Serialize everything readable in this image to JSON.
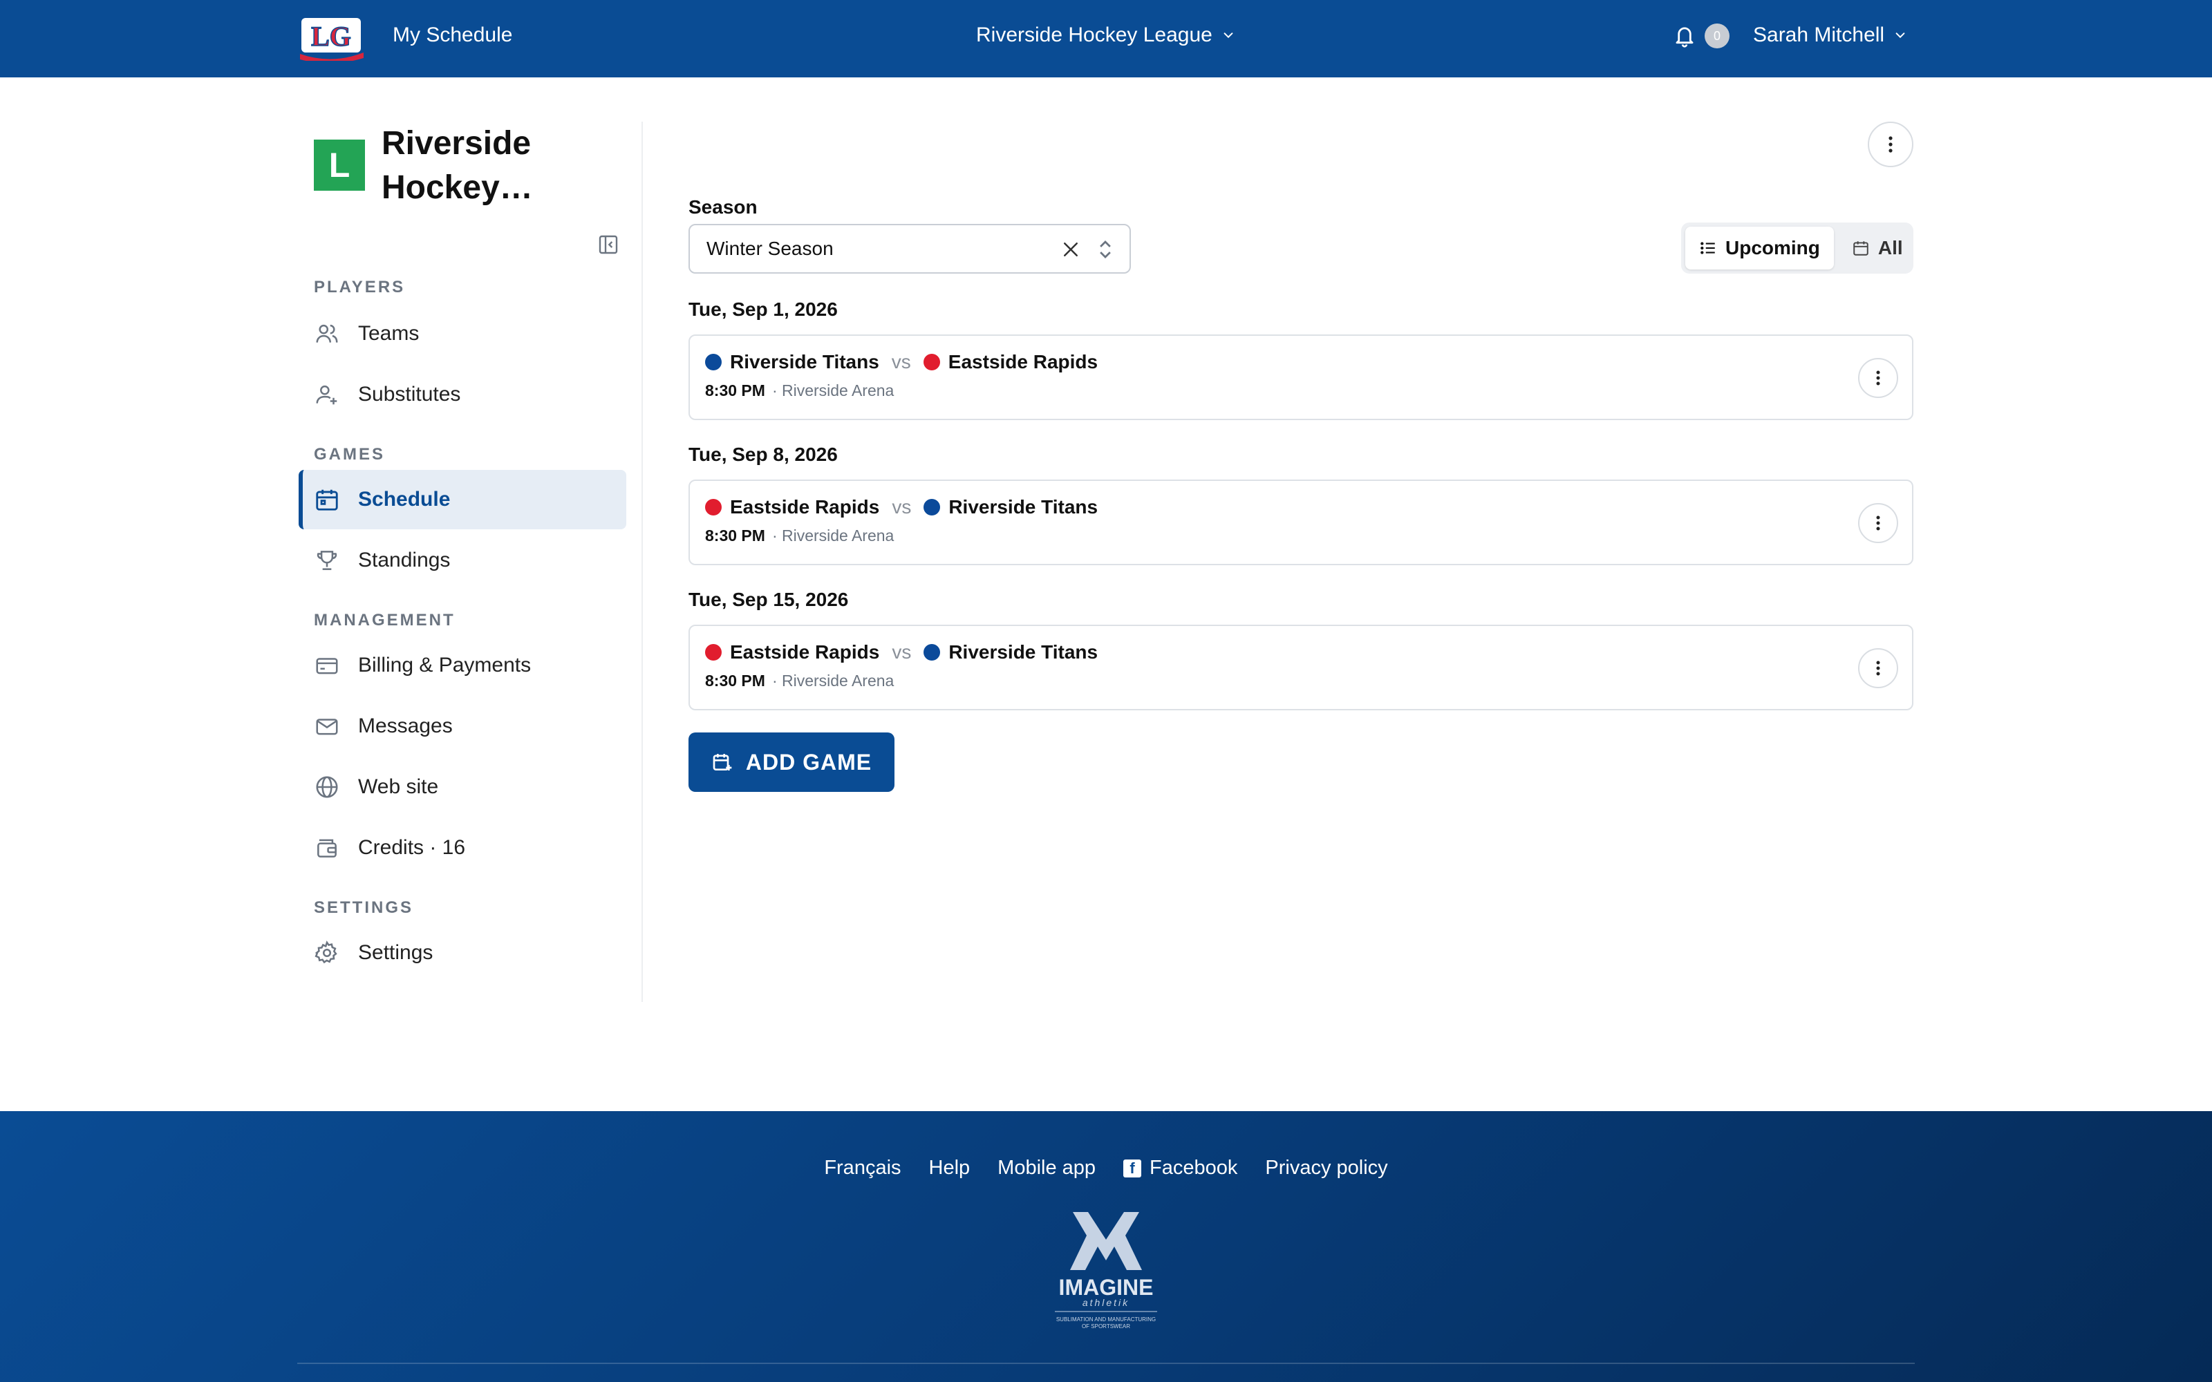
{
  "topbar": {
    "logo_text": "LG",
    "my_schedule": "My Schedule",
    "league_name": "Riverside Hockey League",
    "notifications_count": "0",
    "user_name": "Sarah Mitchell"
  },
  "sidebar": {
    "org_initial": "L",
    "org_name": "Riverside Hockey…",
    "sections": {
      "players": "PLAYERS",
      "games": "GAMES",
      "management": "MANAGEMENT",
      "settings": "SETTINGS"
    },
    "items": {
      "teams": "Teams",
      "substitutes": "Substitutes",
      "schedule": "Schedule",
      "standings": "Standings",
      "billing": "Billing & Payments",
      "messages": "Messages",
      "website": "Web site",
      "credits": "Credits · 16",
      "settings": "Settings"
    }
  },
  "main": {
    "season_label": "Season",
    "season_value": "Winter Season",
    "toggle": {
      "upcoming": "Upcoming",
      "all": "All",
      "selected": "Upcoming"
    },
    "games": [
      {
        "date": "Tue, Sep 1, 2026",
        "home": "Riverside Titans",
        "away": "Eastside Rapids",
        "vs": "vs",
        "time": "8:30 PM",
        "venue": "· Riverside Arena"
      },
      {
        "date": "Tue, Sep 8, 2026",
        "home": "Eastside Rapids",
        "away": "Riverside Titans",
        "vs": "vs",
        "time": "8:30 PM",
        "venue": "· Riverside Arena"
      },
      {
        "date": "Tue, Sep 15, 2026",
        "home": "Eastside Rapids",
        "away": "Riverside Titans",
        "vs": "vs",
        "time": "8:30 PM",
        "venue": "· Riverside Arena"
      }
    ],
    "add_game": "ADD GAME"
  },
  "team_colors": {
    "Riverside Titans": "#0b4a9a",
    "Eastside Rapids": "#e11d2e"
  },
  "footer": {
    "links": {
      "francais": "Français",
      "help": "Help",
      "mobile_app": "Mobile app",
      "facebook": "Facebook",
      "privacy": "Privacy policy"
    },
    "brand": "IMAGINE",
    "brand_sub": "athletik",
    "brand_tagline_1": "SUBLIMATION AND MANUFACTURING",
    "brand_tagline_2": "OF SPORTSWEAR"
  },
  "colors": {
    "primary": "#0a4c94",
    "org_badge": "#23a455"
  }
}
